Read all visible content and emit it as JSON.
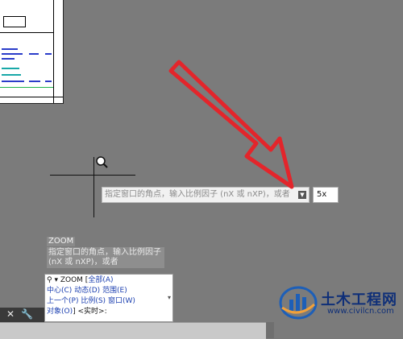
{
  "colors": {
    "canvas": "#7b7b7b",
    "arrow": "#e3252b",
    "option": "#1b3fb0"
  },
  "icons": {
    "magnifier": "zoom-cursor-icon",
    "dropdown": "dropdown-arrow-icon",
    "close": "close-icon",
    "wrench": "wrench-icon",
    "cmd_search": "command-search-icon"
  },
  "dynamic_input": {
    "prompt": "指定窗口的角点，输入比例因子 (nX 或 nXP)，或者",
    "value": "5x"
  },
  "history": {
    "command": "ZOOM",
    "prompt": "指定窗口的角点，输入比例因子 (nX 或 nXP)，或者"
  },
  "command_line": {
    "line1_prefix": "▾ ZOOM [",
    "opt_all": "全部(A)",
    "opt_center": "中心(C)",
    "opt_dynamic": "动态(D)",
    "opt_range": "范围(E)",
    "opt_previous": "上一个(P)",
    "opt_scale": "比例(S)",
    "opt_window": "窗口(W)",
    "opt_object": "对象(O)",
    "line4_suffix": "] <实时>:"
  },
  "watermark": {
    "title": "土木工程网",
    "url": "www.civilcn.com"
  }
}
